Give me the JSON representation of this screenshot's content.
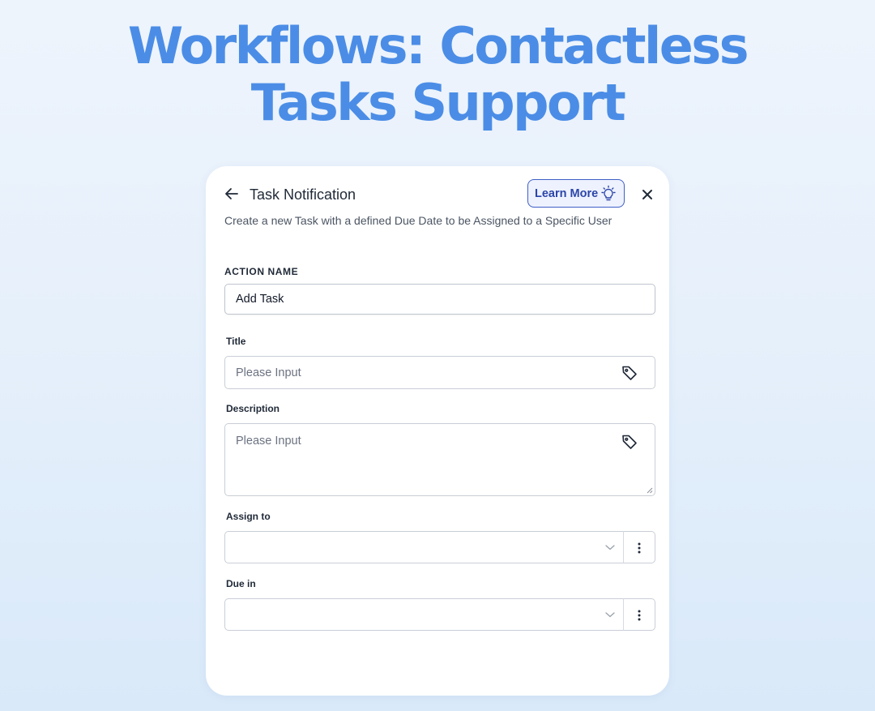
{
  "headline": {
    "line1": "Workflows: Contactless",
    "line2": "Tasks Support"
  },
  "panel": {
    "back_icon": "arrow-left-icon",
    "title": "Task Notification",
    "learn_more_label": "Learn More",
    "learn_more_icon": "lightbulb-icon",
    "close_icon": "close-icon",
    "subtitle": "Create a new Task with a defined Due Date to be Assigned to a Specific User"
  },
  "form": {
    "action_name": {
      "label": "ACTION NAME",
      "value": "Add Task"
    },
    "title": {
      "label": "Title",
      "placeholder": "Please Input",
      "icon": "tag-icon"
    },
    "description": {
      "label": "Description",
      "placeholder": "Please Input",
      "icon": "tag-icon"
    },
    "assign_to": {
      "label": "Assign to",
      "value": "",
      "icon": "chevron-down-icon",
      "menu_icon": "kebab-menu-icon"
    },
    "due_in": {
      "label": "Due in",
      "value": "",
      "icon": "chevron-down-icon",
      "menu_icon": "kebab-menu-icon"
    }
  },
  "colors": {
    "headline": "#4b8de6",
    "accent": "#3f5fc6",
    "background": "#e6f0fb"
  }
}
